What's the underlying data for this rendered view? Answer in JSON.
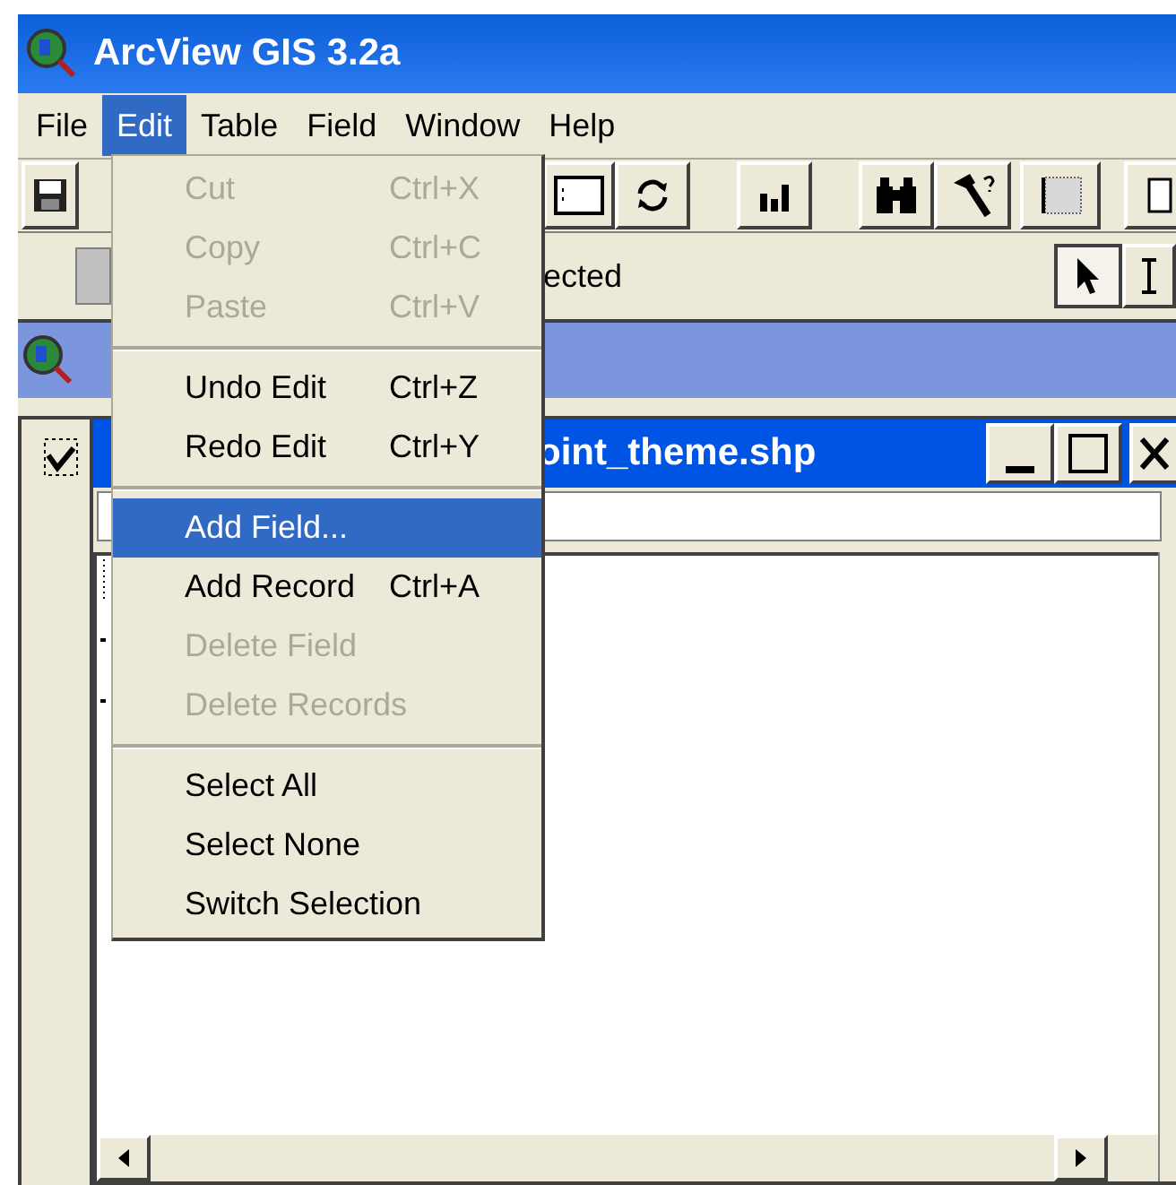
{
  "window": {
    "title": "ArcView GIS 3.2a"
  },
  "menu_bar": [
    {
      "label": "File",
      "selected": false
    },
    {
      "label": "Edit",
      "selected": true
    },
    {
      "label": "Table",
      "selected": false
    },
    {
      "label": "Field",
      "selected": false
    },
    {
      "label": "Window",
      "selected": false
    },
    {
      "label": "Help",
      "selected": false
    }
  ],
  "status_toolbar": {
    "text": "ected"
  },
  "table_window": {
    "title": "oint_theme.shp"
  },
  "edit_menu": [
    {
      "kind": "item",
      "label": "Cut",
      "shortcut": "Ctrl+X",
      "disabled": true,
      "selected": false
    },
    {
      "kind": "item",
      "label": "Copy",
      "shortcut": "Ctrl+C",
      "disabled": true,
      "selected": false
    },
    {
      "kind": "item",
      "label": "Paste",
      "shortcut": "Ctrl+V",
      "disabled": true,
      "selected": false
    },
    {
      "kind": "separator"
    },
    {
      "kind": "item",
      "label": "Undo Edit",
      "shortcut": "Ctrl+Z",
      "disabled": false,
      "selected": false
    },
    {
      "kind": "item",
      "label": "Redo Edit",
      "shortcut": "Ctrl+Y",
      "disabled": false,
      "selected": false
    },
    {
      "kind": "separator"
    },
    {
      "kind": "item",
      "label": "Add Field...",
      "disabled": false,
      "selected": true
    },
    {
      "kind": "item",
      "label": "Add Record",
      "shortcut": "Ctrl+A",
      "disabled": false,
      "selected": false
    },
    {
      "kind": "item",
      "label": "Delete Field",
      "disabled": true,
      "selected": false
    },
    {
      "kind": "item",
      "label": "Delete Records",
      "disabled": true,
      "selected": false
    },
    {
      "kind": "separator"
    },
    {
      "kind": "item",
      "label": "Select All",
      "disabled": false,
      "selected": false
    },
    {
      "kind": "item",
      "label": "Select None",
      "disabled": false,
      "selected": false
    },
    {
      "kind": "item",
      "label": "Switch Selection",
      "disabled": false,
      "selected": false
    }
  ]
}
